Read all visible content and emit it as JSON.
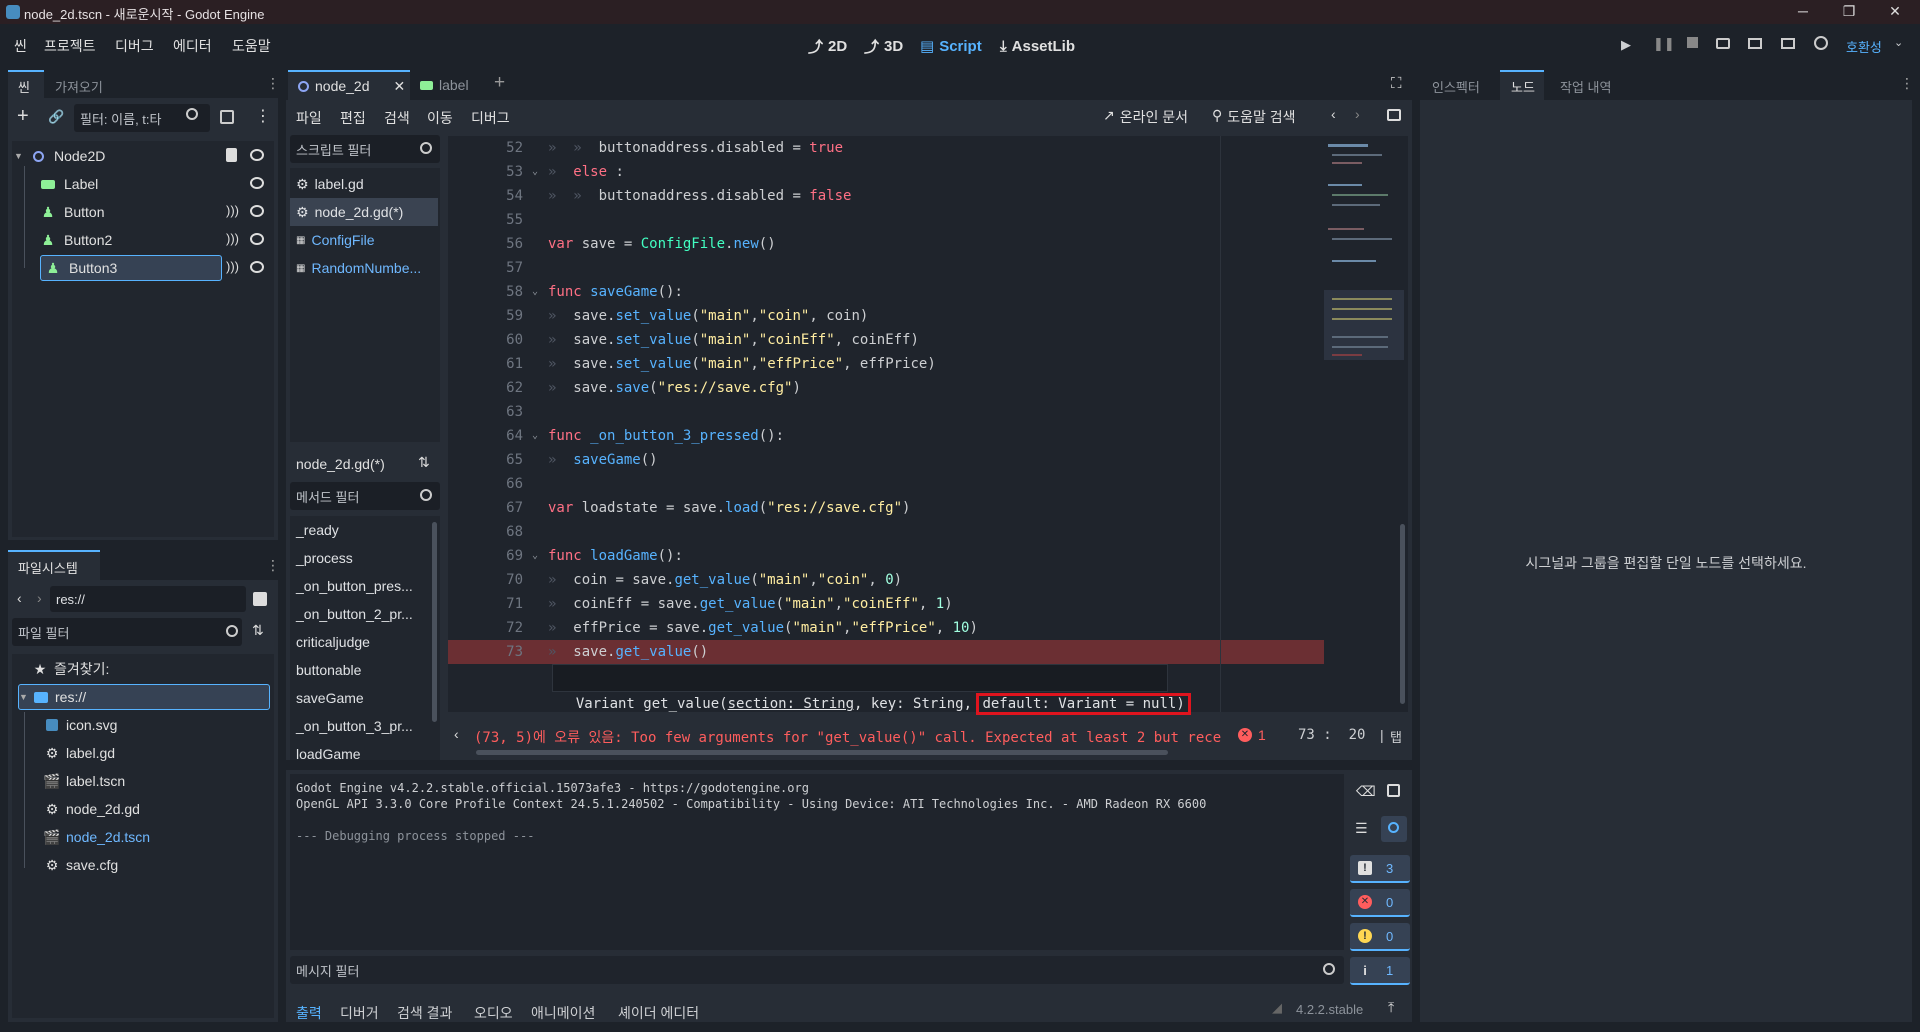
{
  "window": {
    "title": "node_2d.tscn - 새로운시작 - Godot Engine",
    "minimize": "─",
    "maximize": "❐",
    "close": "✕"
  },
  "menu": [
    "씬",
    "프로젝트",
    "디버그",
    "에디터",
    "도움말"
  ],
  "workspaces": [
    "2D",
    "3D",
    "Script",
    "AssetLib"
  ],
  "renderer": "호환성",
  "scene_dock": {
    "tabs": [
      "씬",
      "가져오기"
    ],
    "filter_placeholder": "필터: 이름, t:타",
    "nodes": [
      "Node2D",
      "Label",
      "Button",
      "Button2",
      "Button3"
    ],
    "selected": "Button3"
  },
  "filesystem": {
    "tab": "파일시스템",
    "path": "res://",
    "filter_placeholder": "파일 필터",
    "favorites": "즐겨찾기:",
    "root": "res://",
    "files": [
      "icon.svg",
      "label.gd",
      "label.tscn",
      "node_2d.gd",
      "node_2d.tscn",
      "save.cfg"
    ],
    "highlighted": "node_2d.tscn"
  },
  "editor_tabs": [
    "node_2d",
    "label"
  ],
  "script_menu": [
    "파일",
    "편집",
    "검색",
    "이동",
    "디버그"
  ],
  "online_docs": "온라인 문서",
  "help_search": "도움말 검색",
  "script_filter_placeholder": "스크립트 필터",
  "scripts": [
    "label.gd",
    "node_2d.gd(*)",
    "ConfigFile",
    "RandomNumbe..."
  ],
  "current_script": "node_2d.gd(*)",
  "method_filter_placeholder": "메서드 필터",
  "methods": [
    "_ready",
    "_process",
    "_on_button_pres...",
    "_on_button_2_pr...",
    "criticaljudge",
    "buttonable",
    "saveGame",
    "_on_button_3_pr...",
    "loadGame"
  ],
  "code_lines": [
    {
      "n": "52",
      "t": [
        [
          "tab",
          "»  »  "
        ],
        [
          "id",
          "buttonaddress.disabled = "
        ],
        [
          "kw",
          "true"
        ]
      ]
    },
    {
      "n": "53",
      "t": [
        [
          "tab",
          "»  "
        ],
        [
          "kw",
          "else"
        ],
        [
          "id",
          " :"
        ]
      ]
    },
    {
      "n": "54",
      "t": [
        [
          "tab",
          "»  »  "
        ],
        [
          "id",
          "buttonaddress.disabled = "
        ],
        [
          "kw",
          "false"
        ]
      ]
    },
    {
      "n": "55",
      "t": []
    },
    {
      "n": "56",
      "t": [
        [
          "kw",
          "var"
        ],
        [
          "id",
          " save = "
        ],
        [
          "ty",
          "ConfigFile"
        ],
        [
          "id",
          "."
        ],
        [
          "fn",
          "new"
        ],
        [
          "id",
          "()"
        ]
      ]
    },
    {
      "n": "57",
      "t": []
    },
    {
      "n": "58",
      "t": [
        [
          "kw",
          "func"
        ],
        [
          "id",
          " "
        ],
        [
          "fn",
          "saveGame"
        ],
        [
          "id",
          "():"
        ]
      ]
    },
    {
      "n": "59",
      "t": [
        [
          "tab",
          "»  "
        ],
        [
          "id",
          "save."
        ],
        [
          "fn",
          "set_value"
        ],
        [
          "id",
          "("
        ],
        [
          "st",
          "\"main\""
        ],
        [
          "id",
          ","
        ],
        [
          "st",
          "\"coin\""
        ],
        [
          "id",
          ", coin)"
        ]
      ]
    },
    {
      "n": "60",
      "t": [
        [
          "tab",
          "»  "
        ],
        [
          "id",
          "save."
        ],
        [
          "fn",
          "set_value"
        ],
        [
          "id",
          "("
        ],
        [
          "st",
          "\"main\""
        ],
        [
          "id",
          ","
        ],
        [
          "st",
          "\"coinEff\""
        ],
        [
          "id",
          ", coinEff)"
        ]
      ]
    },
    {
      "n": "61",
      "t": [
        [
          "tab",
          "»  "
        ],
        [
          "id",
          "save."
        ],
        [
          "fn",
          "set_value"
        ],
        [
          "id",
          "("
        ],
        [
          "st",
          "\"main\""
        ],
        [
          "id",
          ","
        ],
        [
          "st",
          "\"effPrice\""
        ],
        [
          "id",
          ", effPrice)"
        ]
      ]
    },
    {
      "n": "62",
      "t": [
        [
          "tab",
          "»  "
        ],
        [
          "id",
          "save."
        ],
        [
          "fn",
          "save"
        ],
        [
          "id",
          "("
        ],
        [
          "st",
          "\"res://save.cfg\""
        ],
        [
          "id",
          ")"
        ]
      ]
    },
    {
      "n": "63",
      "t": []
    },
    {
      "n": "64",
      "t": [
        [
          "kw",
          "func"
        ],
        [
          "id",
          " "
        ],
        [
          "fn",
          "_on_button_3_pressed"
        ],
        [
          "id",
          "():"
        ]
      ]
    },
    {
      "n": "65",
      "t": [
        [
          "tab",
          "»  "
        ],
        [
          "fn",
          "saveGame"
        ],
        [
          "id",
          "()"
        ]
      ]
    },
    {
      "n": "66",
      "t": []
    },
    {
      "n": "67",
      "t": [
        [
          "kw",
          "var"
        ],
        [
          "id",
          " loadstate = save."
        ],
        [
          "fn",
          "load"
        ],
        [
          "id",
          "("
        ],
        [
          "st",
          "\"res://save.cfg\""
        ],
        [
          "id",
          ")"
        ]
      ]
    },
    {
      "n": "68",
      "t": []
    },
    {
      "n": "69",
      "t": [
        [
          "kw",
          "func"
        ],
        [
          "id",
          " "
        ],
        [
          "fn",
          "loadGame"
        ],
        [
          "id",
          "():"
        ]
      ]
    },
    {
      "n": "70",
      "t": [
        [
          "tab",
          "»  "
        ],
        [
          "id",
          "coin = save."
        ],
        [
          "fn",
          "get_value"
        ],
        [
          "id",
          "("
        ],
        [
          "st",
          "\"main\""
        ],
        [
          "id",
          ","
        ],
        [
          "st",
          "\"coin\""
        ],
        [
          "id",
          ", "
        ],
        [
          "nm",
          "0"
        ],
        [
          "id",
          ")"
        ]
      ]
    },
    {
      "n": "71",
      "t": [
        [
          "tab",
          "»  "
        ],
        [
          "id",
          "coinEff = save."
        ],
        [
          "fn",
          "get_value"
        ],
        [
          "id",
          "("
        ],
        [
          "st",
          "\"main\""
        ],
        [
          "id",
          ","
        ],
        [
          "st",
          "\"coinEff\""
        ],
        [
          "id",
          ", "
        ],
        [
          "nm",
          "1"
        ],
        [
          "id",
          ")"
        ]
      ]
    },
    {
      "n": "72",
      "t": [
        [
          "tab",
          "»  "
        ],
        [
          "id",
          "effPrice = save."
        ],
        [
          "fn",
          "get_value"
        ],
        [
          "id",
          "("
        ],
        [
          "st",
          "\"main\""
        ],
        [
          "id",
          ","
        ],
        [
          "st",
          "\"effPrice\""
        ],
        [
          "id",
          ", "
        ],
        [
          "nm",
          "10"
        ],
        [
          "id",
          ")"
        ]
      ]
    },
    {
      "n": "73",
      "t": [
        [
          "tab",
          "»  "
        ],
        [
          "id",
          "save."
        ],
        [
          "fn",
          "get_value"
        ],
        [
          "id",
          "()"
        ]
      ]
    }
  ],
  "tooltip": {
    "prefix": "Variant get_value(",
    "section": "section: String",
    "mid": ", key: String, ",
    "highlight": "default: Variant = null)"
  },
  "error_bar": {
    "message": "(73, 5)에 오류 있음: Too few arguments for \"get_value()\" call. Expected at least 2 but rece",
    "count": "1",
    "position": "73 :  20",
    "indent": "탭"
  },
  "output": {
    "lines": [
      "Godot Engine v4.2.2.stable.official.15073afe3 - https://godotengine.org",
      "OpenGL API 3.3.0 Core Profile Context 24.5.1.240502 - Compatibility - Using Device: ATI Technologies Inc. - AMD Radeon RX 6600",
      "",
      "--- Debugging process stopped ---"
    ],
    "filter_placeholder": "메시지 필터",
    "counts": {
      "messages": "3",
      "errors": "0",
      "warnings": "0",
      "info": "1"
    }
  },
  "bottom_tabs": [
    "출력",
    "디버거",
    "검색 결과",
    "오디오",
    "애니메이션",
    "셰이더 에디터"
  ],
  "version": "4.2.2.stable",
  "right_dock": {
    "tabs": [
      "인스펙터",
      "노드",
      "작업 내역"
    ],
    "message": "시그널과 그룹을 편집할 단일 노드를 선택하세요."
  },
  "colors": {
    "accent": "#57b3ff",
    "error": "#ff5d5d",
    "warning": "#ffd752",
    "error_line_bg": "#6b2f33",
    "highlight_box": "#e0141e"
  }
}
